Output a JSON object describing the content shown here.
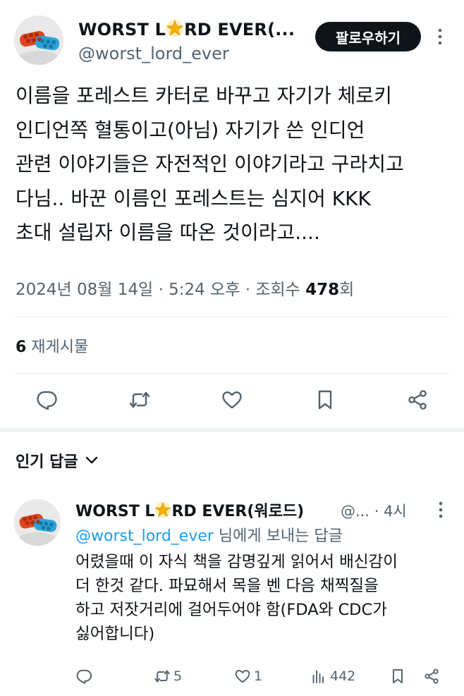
{
  "tweet": {
    "author_name_pre": "WORST L",
    "author_name_post": "RD EVER(...",
    "handle": "@worst_lord_ever",
    "follow_label": "팔로우하기",
    "body_lines": [
      "이름을 포레스트 카터로 바꾸고 자기가 체로키",
      "인디언쪽 혈통이고(아님) 자기가 쓴 인디언",
      "관련 이야기들은 자전적인 이야기라고 구라치고",
      "다님.. 바꾼 이름인 포레스트는 심지어 KKK",
      "초대 설립자 이름을 따온 것이라고...."
    ],
    "date_time": "2024년 08월 14일 · 5:24 오후 · 조회수 ",
    "views_count": "478",
    "views_suffix": "회",
    "repost_count": "6",
    "repost_label": " 재게시물"
  },
  "actions": {
    "icons": [
      "reply-icon",
      "repost-icon",
      "like-icon",
      "bookmark-icon",
      "share-icon"
    ]
  },
  "replies_section": {
    "title": "인기 답글"
  },
  "reply": {
    "author_name_pre": "WORST L",
    "author_name_post": "RD EVER(워로드)",
    "handle_trunc": "@...",
    "time": "· 4시",
    "replying_to_mention": "@worst_lord_ever",
    "replying_to_suffix": " 님에게 보내는 답글",
    "body_lines": [
      "어렸을때 이 자식 책을 감명깊게 읽어서 배신감이",
      "더 한것 같다. 파묘해서 목을 벤 다음 채찍질을",
      "하고 저잣거리에 걸어두어야 함(FDA와  CDC가",
      "싫어합니다)"
    ],
    "stats": {
      "replies": "",
      "reposts": "5",
      "likes": "1",
      "views": "442"
    }
  },
  "colors": {
    "text": "#0f1419",
    "secondary": "#536471",
    "link": "#1d9bf0",
    "follow_bg": "#0f1419"
  }
}
